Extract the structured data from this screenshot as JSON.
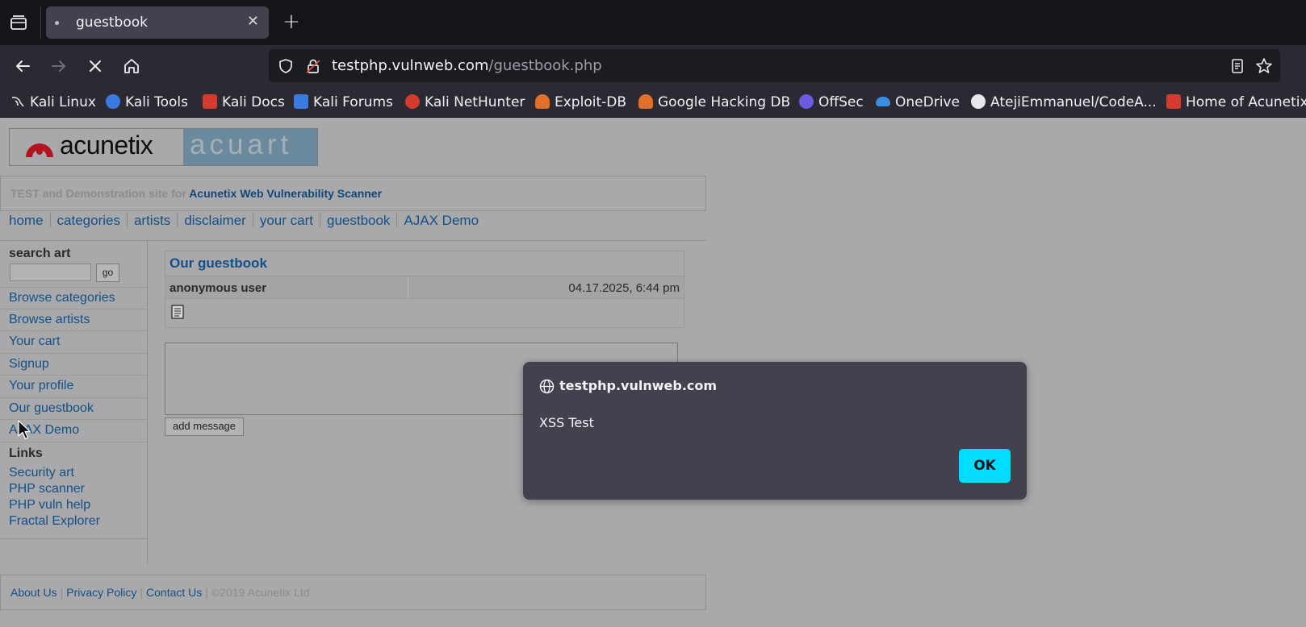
{
  "browser": {
    "tab_title": "guestbook",
    "url_host": "testphp.vulnweb.com",
    "url_path": "/guestbook.php",
    "bookmarks": [
      {
        "label": "Kali Linux",
        "icon": "kali-dragon-icon",
        "color": "#e0e0e0"
      },
      {
        "label": "Kali Tools",
        "icon": "kali-tools-icon",
        "color": "#3b7be0"
      },
      {
        "label": "Kali Docs",
        "icon": "kali-docs-icon",
        "color": "#d43b2f"
      },
      {
        "label": "Kali Forums",
        "icon": "kali-forums-icon",
        "color": "#3b7be0"
      },
      {
        "label": "Kali NetHunter",
        "icon": "kali-nethunter-icon",
        "color": "#d43b2f"
      },
      {
        "label": "Exploit-DB",
        "icon": "exploit-db-icon",
        "color": "#e0702a"
      },
      {
        "label": "Google Hacking DB",
        "icon": "ghdb-icon",
        "color": "#e0702a"
      },
      {
        "label": "OffSec",
        "icon": "offsec-icon",
        "color": "#6a5ce0"
      },
      {
        "label": "OneDrive",
        "icon": "onedrive-icon",
        "color": "#3b8fe0"
      },
      {
        "label": "AtejiEmmanuel/CodeA...",
        "icon": "github-icon",
        "color": "#e8e8ec"
      },
      {
        "label": "Home of Acunetix",
        "icon": "acunetix-icon",
        "color": "#d43b2f"
      }
    ]
  },
  "site": {
    "logo_left": "acunetix",
    "logo_right": "acuart",
    "tagline_prefix": "TEST and Demonstration site for",
    "tagline_link": "Acunetix Web Vulnerability Scanner",
    "top_nav": [
      "home",
      "categories",
      "artists",
      "disclaimer",
      "your cart",
      "guestbook",
      "AJAX Demo"
    ],
    "search_title": "search art",
    "search_value": "",
    "search_button": "go",
    "sidebar_menu": [
      "Browse categories",
      "Browse artists",
      "Your cart",
      "Signup",
      "Your profile",
      "Our guestbook",
      "AJAX Demo"
    ],
    "links_title": "Links",
    "links": [
      "Security art",
      "PHP scanner",
      "PHP vuln help",
      "Fractal Explorer"
    ],
    "guestbook": {
      "title": "Our guestbook",
      "entry_user": "anonymous user",
      "entry_date": "04.17.2025, 6:44 pm",
      "entry_icon": "document-icon"
    },
    "message_value": "",
    "add_message_button": "add message",
    "footer": {
      "links": [
        "About Us",
        "Privacy Policy",
        "Contact Us"
      ],
      "copyright": "©2019 Acunetix Ltd"
    }
  },
  "dialog": {
    "origin": "testphp.vulnweb.com",
    "message": "XSS Test",
    "ok_label": "OK",
    "accent": "#00ddff"
  }
}
